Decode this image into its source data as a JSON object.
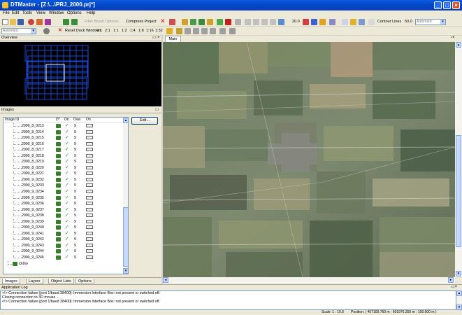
{
  "window": {
    "title": "DTMaster - [Z:\\...\\PRJ_2000.prj*]"
  },
  "menu": [
    "File",
    "Edit",
    "Tools",
    "View",
    "Window",
    "Options",
    "Help"
  ],
  "toolbar1": {
    "filter_brush": "Filter Brush Options",
    "compress_project": "Compress Project",
    "zoom_value": "20.0",
    "contour_lines": "Contour Lines",
    "contour_value": "50.0",
    "contour_combo": "Automatic"
  },
  "toolbar2": {
    "mode_combo": "Automatic",
    "reset_dock": "Reset Dock Windows",
    "scales": [
      "4:1",
      "2:1",
      "1:1",
      "1:2",
      "1:4",
      "1:8",
      "1:16",
      "1:32"
    ]
  },
  "overview": {
    "title": "Overview"
  },
  "images": {
    "title": "Images",
    "columns": [
      "Image ID",
      "D*",
      "Ori",
      "Ovw",
      "On"
    ],
    "edit_label": "Edit...",
    "rows": [
      {
        "id": "2000_8_0213",
        "ovw": "9"
      },
      {
        "id": "2000_8_0214",
        "ovw": "9"
      },
      {
        "id": "2000_8_0215",
        "ovw": "9"
      },
      {
        "id": "2000_8_0216",
        "ovw": "9"
      },
      {
        "id": "2000_8_0217",
        "ovw": "9"
      },
      {
        "id": "2000_8_0218",
        "ovw": "9"
      },
      {
        "id": "2000_8_0219",
        "ovw": "9"
      },
      {
        "id": "2000_8_0220",
        "ovw": "9"
      },
      {
        "id": "2000_8_0221",
        "ovw": "9"
      },
      {
        "id": "2000_9_0232",
        "ovw": "9"
      },
      {
        "id": "2000_9_0233",
        "ovw": "9"
      },
      {
        "id": "2000_9_0234",
        "ovw": "9"
      },
      {
        "id": "2000_9_0235",
        "ovw": "9"
      },
      {
        "id": "2000_9_0236",
        "ovw": "9"
      },
      {
        "id": "2000_9_0237",
        "ovw": "9"
      },
      {
        "id": "2000_9_0238",
        "ovw": "9"
      },
      {
        "id": "2000_9_0239",
        "ovw": "9"
      },
      {
        "id": "2000_9_0240",
        "ovw": "9"
      },
      {
        "id": "2000_9_0241",
        "ovw": "9"
      },
      {
        "id": "2000_9_0242",
        "ovw": "9"
      },
      {
        "id": "2000_9_0243",
        "ovw": "9"
      },
      {
        "id": "2000_9_0244",
        "ovw": "9"
      },
      {
        "id": "2000_9_0245",
        "ovw": "9"
      }
    ],
    "ortho_label": "Ortho"
  },
  "bottom_tabs": [
    "Images",
    "Layers",
    "Object Lists",
    "Options"
  ],
  "main_tab": "Main",
  "app_log": {
    "title": "Application Log",
    "lines": [
      "<!> Connection failure [port 1/baud 38400]: Immersion Interface Box: not present or switched off.",
      "Closing connection to 3D mouse ...",
      "<!> Connection failure [port 1/baud 38400]: Immersion Interface Box: not present or switched off."
    ]
  },
  "status": {
    "scale": "Scale: 1 : 10.6",
    "position": "Position: ( 457100.760 m ; 691976.250 m ; 100.000 m )"
  },
  "colors": {
    "title_blue": "#0246c6",
    "overview_lines": "#2255ff",
    "check_green": "#2d8a2d"
  }
}
